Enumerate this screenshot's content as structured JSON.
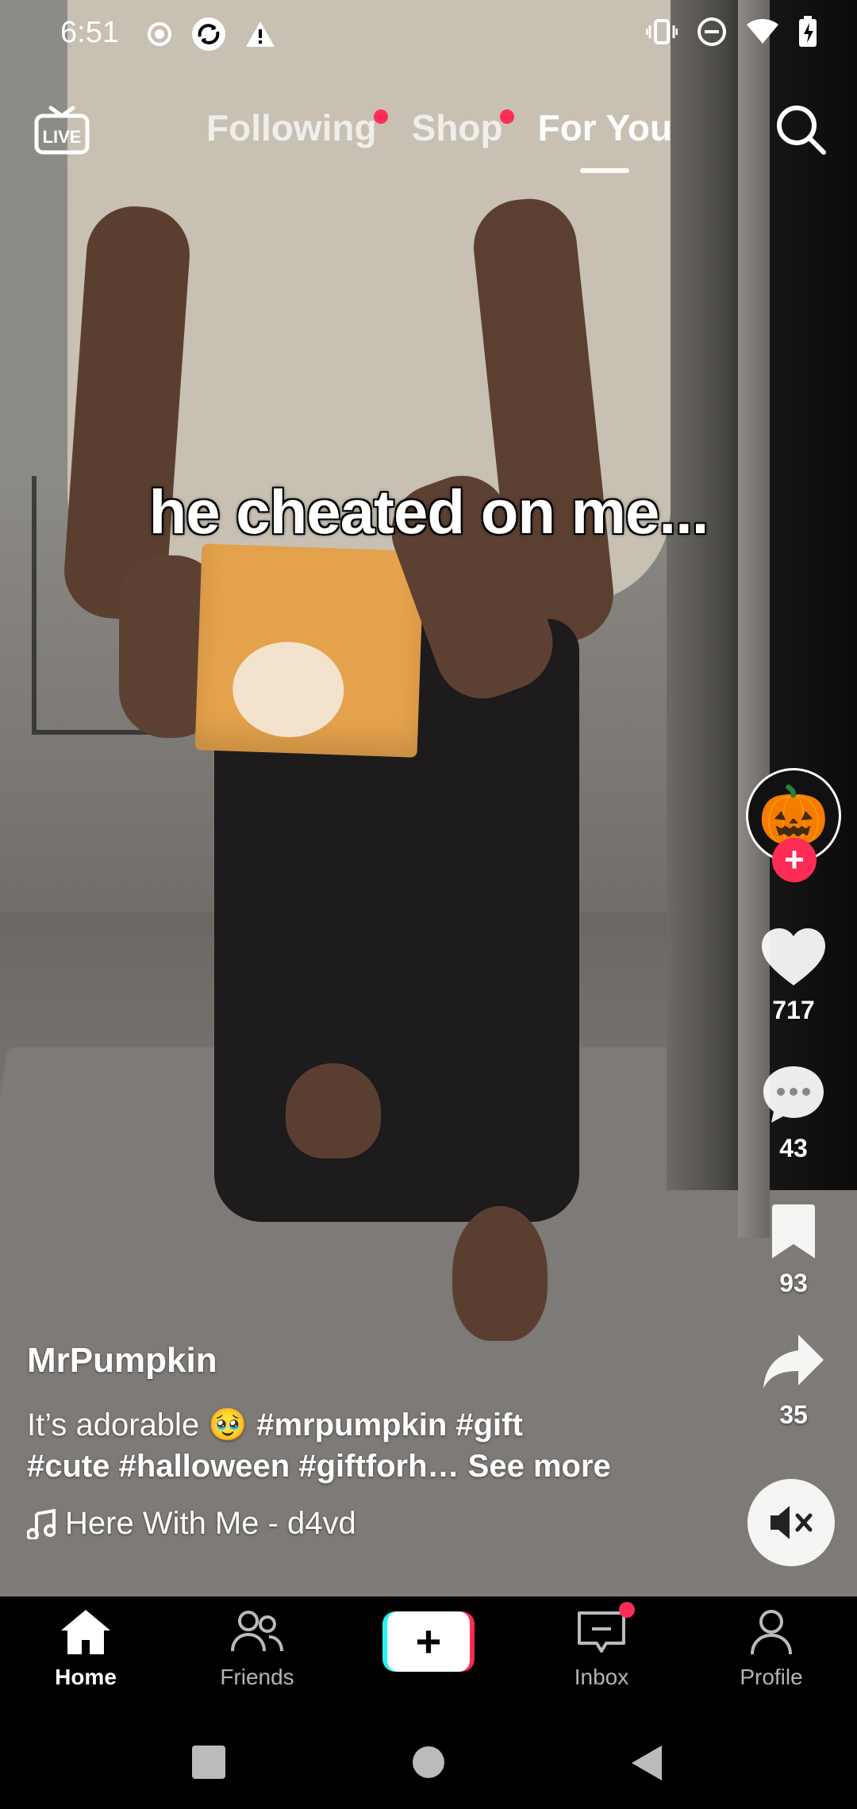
{
  "status_bar": {
    "time": "6:51",
    "left_icons": [
      "record-icon",
      "sync-icon",
      "warning-icon"
    ],
    "right_icons": [
      "vibrate-icon",
      "dnd-icon",
      "wifi-icon",
      "battery-charging-icon"
    ]
  },
  "top_nav": {
    "live_icon_label": "LIVE",
    "tabs": [
      {
        "label": "Following",
        "has_dot": true,
        "active": false
      },
      {
        "label": "Shop",
        "has_dot": true,
        "active": false
      },
      {
        "label": "For You",
        "has_dot": false,
        "active": true
      }
    ]
  },
  "video": {
    "caption": "he cheated on me..."
  },
  "rail": {
    "avatar_emoji": "🎃",
    "follow_label": "+",
    "like_count": "717",
    "comment_count": "43",
    "bookmark_count": "93",
    "share_count": "35"
  },
  "info": {
    "username": "MrPumpkin",
    "desc_prefix": "It’s adorable 🥹 ",
    "tags_line1": "#mrpumpkin #gift",
    "tags_line2": "#cute #halloween #giftforh…",
    "see_more": "See more",
    "music": "Here With Me - d4vd"
  },
  "tabbar": {
    "home": "Home",
    "friends": "Friends",
    "create": "+",
    "inbox": "Inbox",
    "profile": "Profile"
  },
  "colors": {
    "accent": "#fe2c55",
    "cyan": "#25f4ee"
  }
}
